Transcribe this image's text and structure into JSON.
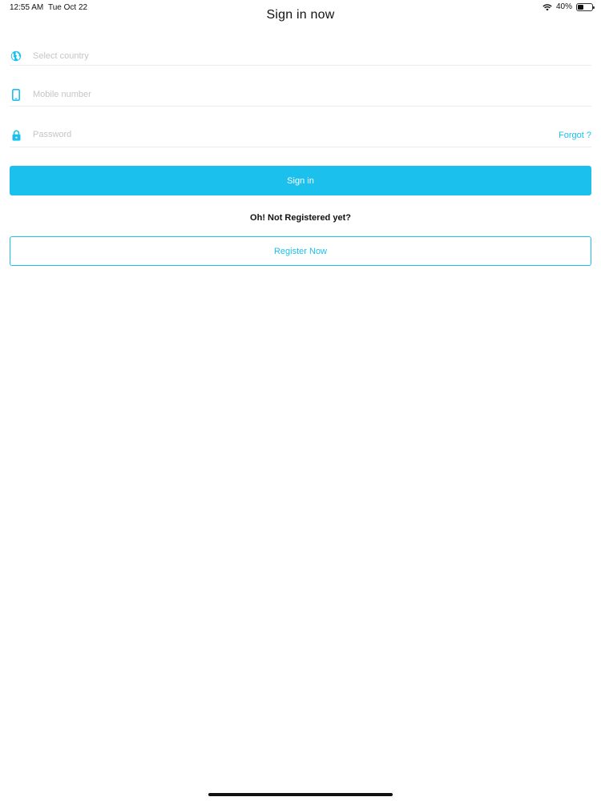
{
  "status_bar": {
    "time": "12:55 AM",
    "date": "Tue Oct 22",
    "battery_text": "40%",
    "battery_level": 0.4
  },
  "header": {
    "title": "Sign in now"
  },
  "form": {
    "country": {
      "placeholder": "Select country",
      "value": "",
      "icon": "globe-icon"
    },
    "mobile": {
      "placeholder": "Mobile number",
      "value": "",
      "icon": "phone-icon"
    },
    "password": {
      "placeholder": "Password",
      "value": "",
      "icon": "lock-icon"
    },
    "forgot_label": "Forgot ?"
  },
  "actions": {
    "signin_label": "Sign in",
    "not_registered_text": "Oh! Not Registered yet?",
    "register_label": "Register Now"
  },
  "colors": {
    "accent": "#1bc0ec",
    "placeholder": "#c5c5c5",
    "divider": "#ececec"
  }
}
